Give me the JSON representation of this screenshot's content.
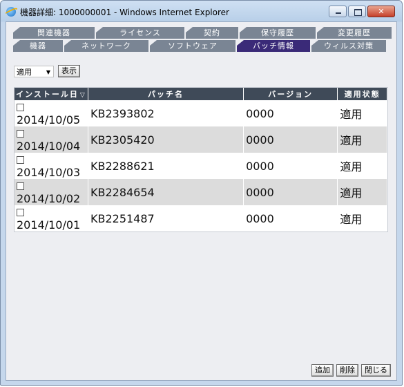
{
  "window": {
    "title": "機器詳細: 1000000001 - Windows Internet Explorer",
    "minimize_label": "",
    "maximize_label": "",
    "close_label": "✕"
  },
  "tabs_row1": [
    {
      "label": "関連機器",
      "width": 118
    },
    {
      "label": "ライセンス",
      "width": 128
    },
    {
      "label": "契約",
      "width": 76
    },
    {
      "label": "保守履歴",
      "width": 110
    },
    {
      "label": "変更履歴",
      "width": 108
    }
  ],
  "tabs_row2": [
    {
      "label": "機器",
      "width": 72
    },
    {
      "label": "ネットワーク",
      "width": 122
    },
    {
      "label": "ソフトウェア",
      "width": 124
    },
    {
      "label": "パッチ情報",
      "width": 106,
      "active": true
    },
    {
      "label": "ウィルス対策",
      "width": 108
    }
  ],
  "filter": {
    "selected": "適用",
    "display_button": "表示"
  },
  "table": {
    "columns": [
      "インストール日",
      "パッチ名",
      "バージョン",
      "適用状態"
    ],
    "rows": [
      {
        "date": "2014/10/05",
        "patch": "KB2393802",
        "version": "0000",
        "status": "適用"
      },
      {
        "date": "2014/10/04",
        "patch": "KB2305420",
        "version": "0000",
        "status": "適用"
      },
      {
        "date": "2014/10/03",
        "patch": "KB2288621",
        "version": "0000",
        "status": "適用"
      },
      {
        "date": "2014/10/02",
        "patch": "KB2284654",
        "version": "0000",
        "status": "適用"
      },
      {
        "date": "2014/10/01",
        "patch": "KB2251487",
        "version": "0000",
        "status": "適用"
      }
    ]
  },
  "buttons": {
    "add": "追加",
    "delete": "削除",
    "close": "閉じる"
  },
  "icons": {
    "browser": "ie-icon",
    "sort": "sort-icon",
    "dropdown": "chevron-down-icon"
  },
  "colors": {
    "tab": "#7a8594",
    "tab_active": "#3a2a78",
    "header": "#3f4a58",
    "alt_row": "#dcdcdc"
  }
}
